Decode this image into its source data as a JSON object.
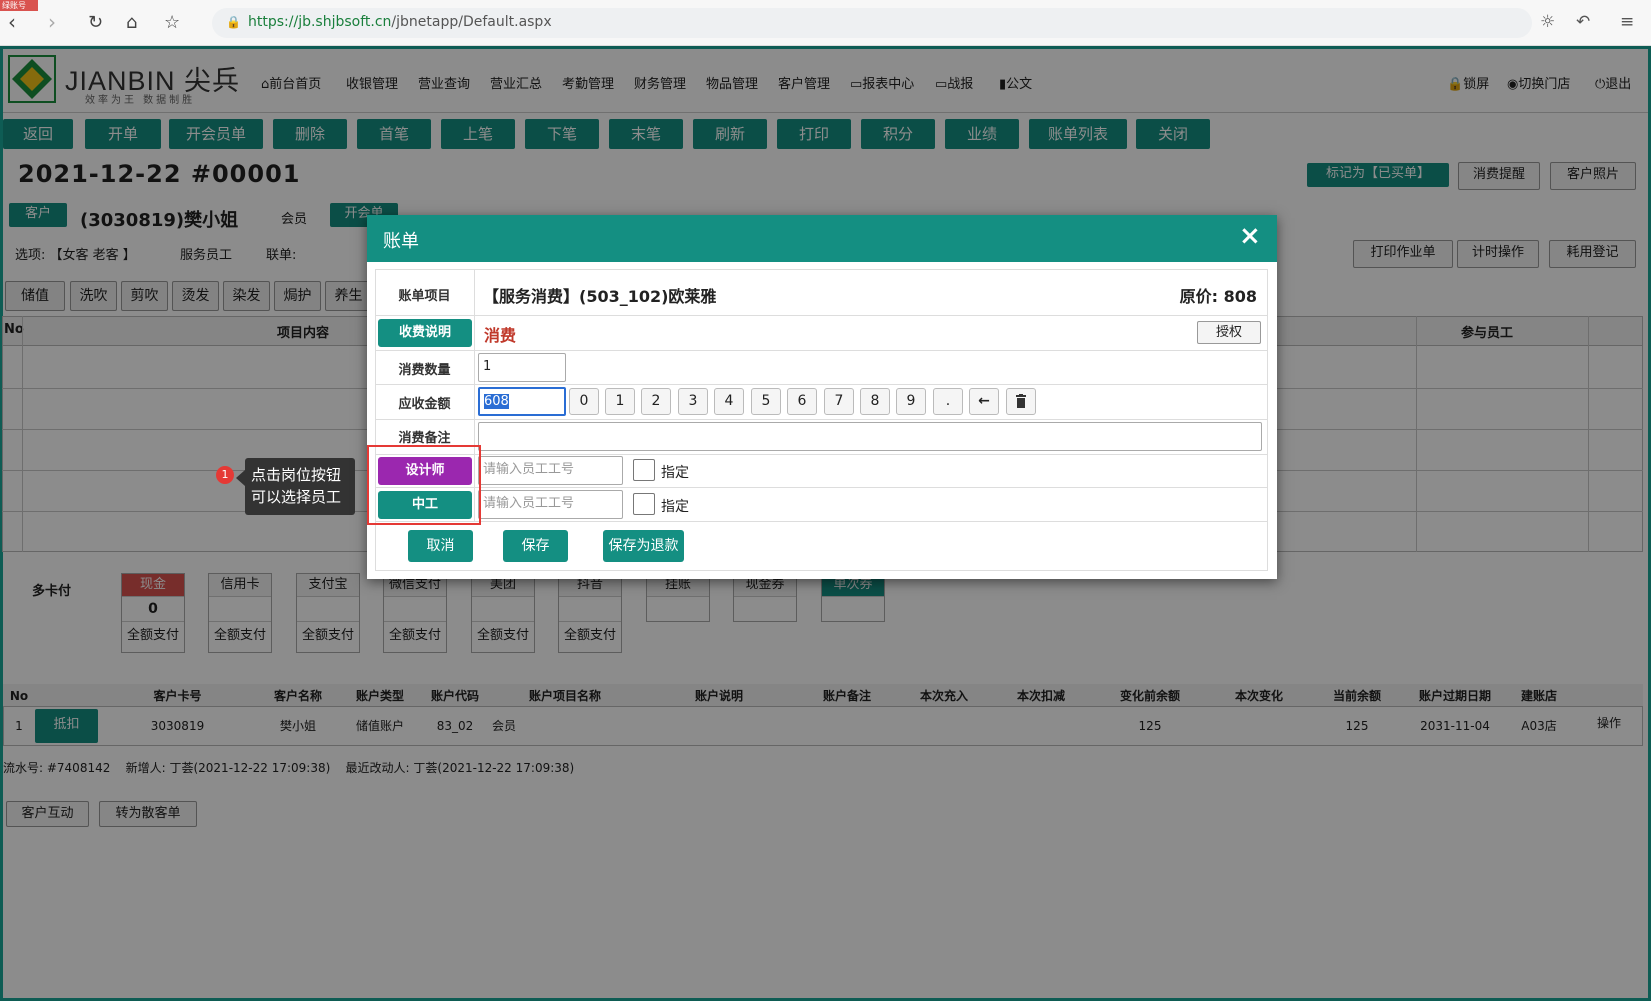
{
  "browser": {
    "tag": "绿账号",
    "url_secure": "https://",
    "url_host": "jb.shjbsoft.cn",
    "url_path": "/jbnetapp/Default.aspx"
  },
  "brand": {
    "name": "JIANBIN 尖兵",
    "slogan": "效率为王  数据制胜"
  },
  "menu": [
    "前台首页",
    "收银管理",
    "营业查询",
    "营业汇总",
    "考勤管理",
    "财务管理",
    "物品管理",
    "客户管理",
    "报表中心",
    "战报",
    "公文"
  ],
  "header_right": [
    "锁屏",
    "切换门店",
    "退出"
  ],
  "toolbar": [
    "返回",
    "开单",
    "开会员单",
    "删除",
    "首笔",
    "上笔",
    "下笔",
    "末笔",
    "刷新",
    "打印",
    "积分",
    "业绩",
    "账单列表",
    "关闭"
  ],
  "order": {
    "title": "2021-12-22  #00001",
    "customer_btn": "客户",
    "customer_name": "(3030819)樊小姐",
    "member_label": "会员",
    "open_btn": "开会单",
    "options_label": "选项: 【女客 老客 】",
    "service_staff": "服务员工",
    "joint": "联单:",
    "mark_btn": "标记为【已买单】",
    "remind_btn": "消费提醒",
    "photo_btn": "客户照片",
    "print_job_btn": "打印作业单",
    "timer_btn": "计时操作",
    "consume_btn": "耗用登记"
  },
  "categories": [
    "储值",
    "洗吹",
    "剪吹",
    "烫发",
    "染发",
    "焗护",
    "养生"
  ],
  "main_table": {
    "col_no": "No",
    "col_content": "项目内容",
    "col_staff": "参与员工"
  },
  "payments": {
    "multi_card": "多卡付",
    "methods": [
      {
        "label": "现金",
        "value": "0",
        "all": "全额支付",
        "highlight": true
      },
      {
        "label": "信用卡",
        "value": "",
        "all": "全额支付"
      },
      {
        "label": "支付宝",
        "value": "",
        "all": "全额支付"
      },
      {
        "label": "微信支付",
        "value": "",
        "all": "全额支付"
      },
      {
        "label": "美团",
        "value": "",
        "all": "全额支付"
      },
      {
        "label": "抖音",
        "value": "",
        "all": "全额支付"
      },
      {
        "label": "挂账",
        "value": "",
        "all": ""
      },
      {
        "label": "现金券",
        "value": "",
        "all": ""
      },
      {
        "label": "单次券",
        "value": "",
        "all": ""
      }
    ]
  },
  "accounts": {
    "headers": [
      "No",
      "",
      "客户卡号",
      "客户名称",
      "账户类型",
      "账户代码",
      "账户项目名称",
      "账户说明",
      "账户备注",
      "本次充入",
      "本次扣减",
      "变化前余额",
      "本次变化",
      "当前余额",
      "账户过期日期",
      "建账店",
      ""
    ],
    "rows": [
      {
        "no": "1",
        "btn": "抵扣",
        "card": "3030819",
        "name": "樊小姐",
        "type": "储值账户",
        "code": "83_02",
        "item": "会员",
        "desc": "",
        "remark": "",
        "in": "",
        "out": "",
        "before": "125",
        "change": "",
        "balance": "125",
        "expire": "2031-11-04",
        "store": "A03店",
        "op": "操作"
      }
    ]
  },
  "footer": {
    "info": "流水号: #7408142    新增人: 丁荟(2021-12-22 17:09:38)    最近改动人: 丁荟(2021-12-22 17:09:38)",
    "btn_interact": "客户互动",
    "btn_convert": "转为散客单"
  },
  "modal": {
    "title": "账单",
    "close": "×",
    "item_label": "账单项目",
    "item_value": "【服务消费】(503_102)欧莱雅",
    "orig_price": "原价: 808",
    "charge_label": "收费说明",
    "charge_value": "消费",
    "auth_btn": "授权",
    "qty_label": "消费数量",
    "qty_value": "1",
    "amount_label": "应收金额",
    "amount_value": "608",
    "keys": [
      "0",
      "1",
      "2",
      "3",
      "4",
      "5",
      "6",
      "7",
      "8",
      "9",
      "."
    ],
    "remark_label": "消费备注",
    "roles": [
      {
        "label": "设计师",
        "placeholder": "请输入员工工号",
        "assign": "指定",
        "color": "#9b27af"
      },
      {
        "label": "中工",
        "placeholder": "请输入员工工号",
        "assign": "指定",
        "color": "#148f82"
      }
    ],
    "cancel": "取消",
    "save": "保存",
    "save_refund": "保存为退款"
  },
  "tooltip": {
    "step": "1",
    "line1": "点击岗位按钮",
    "line2": "可以选择员工"
  }
}
